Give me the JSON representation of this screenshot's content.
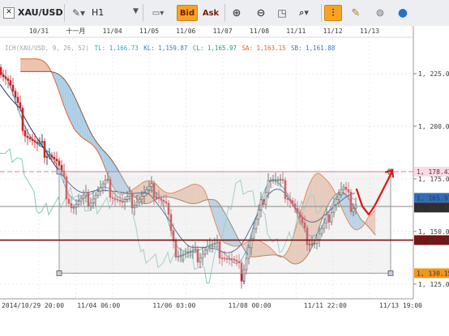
{
  "toolbar": {
    "symbol": "XAU/USD",
    "timeframe": "H1",
    "bid_label": "Bid",
    "ask_label": "Ask"
  },
  "chart_data": {
    "type": "candlestick",
    "symbol": "XAU/USD",
    "timeframe": "H1",
    "indicator": {
      "name": "ICH(XAU/USD, 9, 26, 52)",
      "values": [
        {
          "key": "TL",
          "value": "1,166.73",
          "color": "#2aa7c8"
        },
        {
          "key": "KL",
          "value": "1,159.87",
          "color": "#3b7ea9"
        },
        {
          "key": "CL",
          "value": "1,165.97",
          "color": "#1e9a86"
        },
        {
          "key": "SA",
          "value": "1,163.15",
          "color": "#e0632a"
        },
        {
          "key": "SB",
          "value": "1,161.88",
          "color": "#3b76c0"
        }
      ],
      "colors": {
        "tenkan": "#2aa7c8",
        "kijun": "#1f2f6a",
        "chikou": "#82c9c0",
        "cloud_bull": "#e9b79c",
        "cloud_bear": "#9cc5e4"
      }
    },
    "y_ticks": [
      "1, 225.00",
      "1, 200.00",
      "1, 175.00",
      "1, 150.00",
      "1, 125.00"
    ],
    "top_date_labels": [
      "10/31",
      "十一月",
      "11/04",
      "11/05",
      "11/06",
      "11/07",
      "11/08",
      "11/11",
      "11/12",
      "11/13"
    ],
    "bottom_time_labels": [
      "2014/10/29 20:00",
      "11/04 06:00",
      "11/06 03:00",
      "11/08 00:00",
      "11/11 22:00",
      "11/13 19:00"
    ],
    "price_tags": [
      {
        "label": "1, 178.43",
        "price": 1178.43,
        "bg": "#ffd8e6",
        "fg": "#333333"
      },
      {
        "label": "1, 165.97",
        "price": 1165.97,
        "bg": "#2f6dbb",
        "fg": "#ffffff"
      },
      {
        "label": "1, 161.88",
        "price": 1161.88,
        "bg": "#2d2d2d",
        "fg": "#ffffff"
      },
      {
        "label": "1, 145.88",
        "price": 1145.88,
        "bg": "#7a1212",
        "fg": "#ffffff"
      },
      {
        "label": "1, 130.15",
        "price": 1130.15,
        "bg": "#f29618",
        "fg": "#222222"
      }
    ],
    "horizontal_lines": [
      {
        "name": "pink-dashed-line",
        "price": 1178.43,
        "color": "#e86fa0"
      },
      {
        "name": "gray-support-line",
        "price": 1161.88,
        "color": "#8a8a8a"
      },
      {
        "name": "dark-red-support-line",
        "price": 1145.88,
        "color": "#7a1212"
      }
    ],
    "ylim": [
      1118,
      1240
    ],
    "closing_price": 1163.0,
    "colors": {
      "up": "#1a1a1a",
      "down": "#c8242a",
      "projection_arrow": "#e01414"
    }
  }
}
